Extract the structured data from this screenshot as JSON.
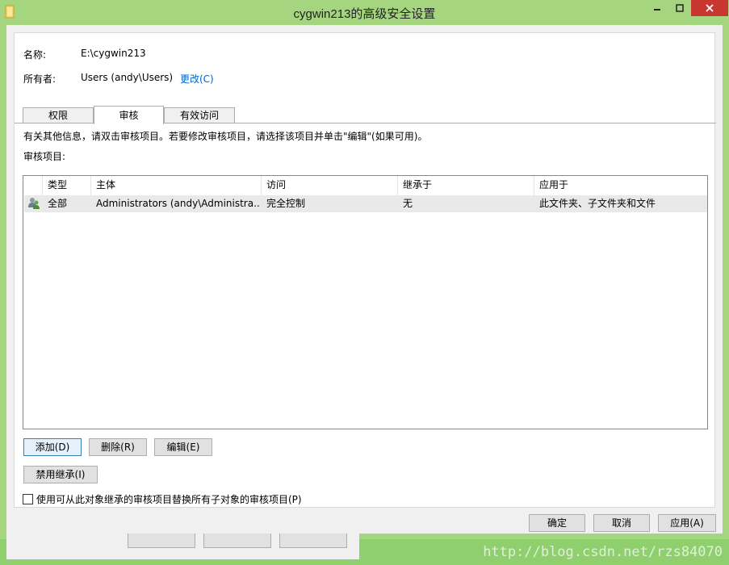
{
  "window": {
    "title": "cygwin213的高级安全设置"
  },
  "info": {
    "name_label": "名称:",
    "name_value": "E:\\cygwin213",
    "owner_label": "所有者:",
    "owner_value": "Users (andy\\Users)",
    "change_link": "更改(C)"
  },
  "tabs": [
    {
      "label": "权限"
    },
    {
      "label": "审核"
    },
    {
      "label": "有效访问"
    }
  ],
  "hint_text": "有关其他信息，请双击审核项目。若要修改审核项目，请选择该项目并单击\"编辑\"(如果可用)。",
  "list_label": "审核项目:",
  "columns": [
    "类型",
    "主体",
    "访问",
    "继承于",
    "应用于"
  ],
  "rows": [
    {
      "type": "全部",
      "principal": "Administrators (andy\\Administra...",
      "access": "完全控制",
      "inherited": "无",
      "applies": "此文件夹、子文件夹和文件"
    }
  ],
  "buttons": {
    "add": "添加(D)",
    "remove": "删除(R)",
    "edit": "编辑(E)",
    "disable_inherit": "禁用继承(I)",
    "ok": "确定",
    "cancel": "取消",
    "apply": "应用(A)"
  },
  "replace_checkbox_label": "使用可从此对象继承的审核项目替换所有子对象的审核项目(P)",
  "replace_checked": false,
  "watermark": "http://blog.csdn.net/rzs84070",
  "colors": {
    "titlebar": "#a5d57f",
    "close": "#c7372f",
    "link": "#0066cc"
  }
}
